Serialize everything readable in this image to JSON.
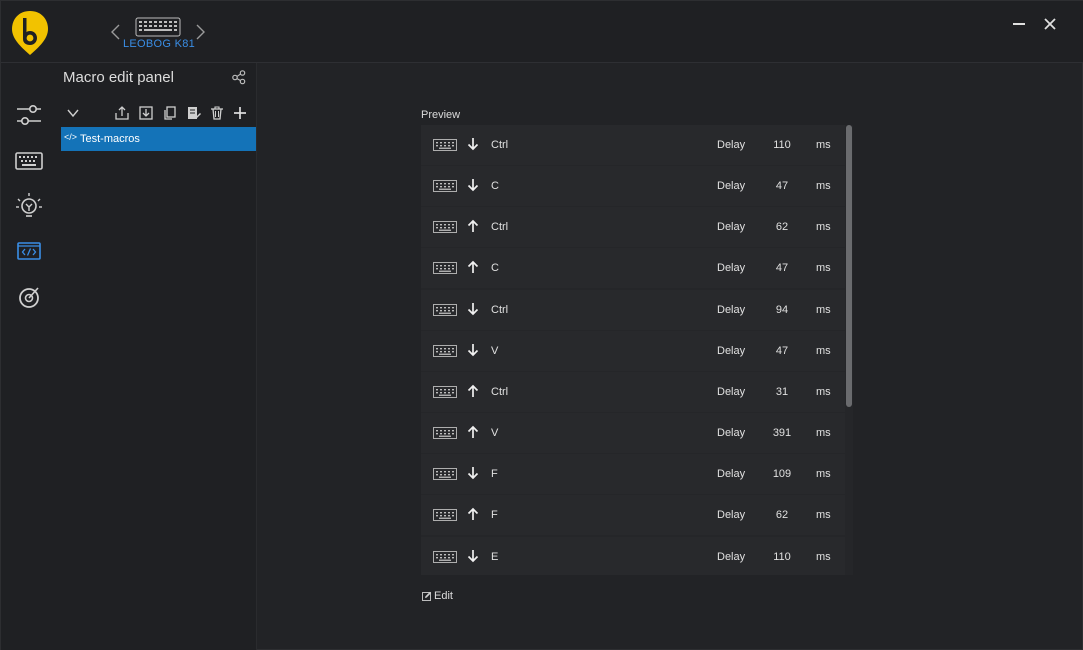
{
  "window": {
    "device_name": "LEOBOG K81",
    "colors": {
      "accent": "#1473b8",
      "brand_yellow": "#f2c200",
      "link_blue": "#3a8ee6"
    }
  },
  "rail": {
    "items": [
      {
        "icon": "sliders-icon"
      },
      {
        "icon": "keyboard-icon"
      },
      {
        "icon": "lightbulb-icon"
      },
      {
        "icon": "macro-code-icon",
        "active": true
      },
      {
        "icon": "target-icon"
      }
    ]
  },
  "panel": {
    "title": "Macro edit panel",
    "macros": [
      {
        "code": "</>",
        "name": "Test-macros"
      }
    ]
  },
  "preview": {
    "label": "Preview",
    "delay_label": "Delay",
    "unit": "ms",
    "rows": [
      {
        "dir": "down",
        "key": "Ctrl",
        "delay": "110"
      },
      {
        "dir": "down",
        "key": "C",
        "delay": "47"
      },
      {
        "dir": "up",
        "key": "Ctrl",
        "delay": "62"
      },
      {
        "dir": "up",
        "key": "C",
        "delay": "47"
      },
      {
        "dir": "down",
        "key": "Ctrl",
        "delay": "94"
      },
      {
        "dir": "down",
        "key": "V",
        "delay": "47"
      },
      {
        "dir": "up",
        "key": "Ctrl",
        "delay": "31"
      },
      {
        "dir": "up",
        "key": "V",
        "delay": "391"
      },
      {
        "dir": "down",
        "key": "F",
        "delay": "109"
      },
      {
        "dir": "up",
        "key": "F",
        "delay": "62"
      },
      {
        "dir": "down",
        "key": "E",
        "delay": "110"
      }
    ]
  },
  "edit": {
    "label": "Edit"
  }
}
